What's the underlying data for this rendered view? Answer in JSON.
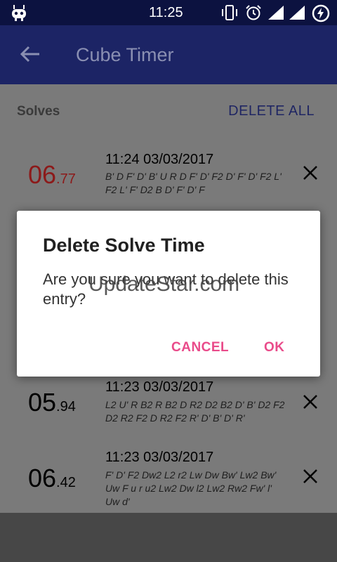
{
  "statusbar": {
    "time": "11:25"
  },
  "appbar": {
    "title": "Cube Timer"
  },
  "solves": {
    "label": "Solves",
    "delete_all": "DELETE ALL"
  },
  "rows": [
    {
      "whole": "06",
      "frac": ".77",
      "date": "11:24 03/03/2017",
      "scramble": "B' D F' D' B' U R D F' D' F2 D' F' D' F2 L' F2 L' F' D2 B D' F' D' F"
    },
    {
      "whole": "05",
      "frac": ".94",
      "date": "11:23 03/03/2017",
      "scramble": "L2 U' R B2 R B2 D R2 D2 B2 D' B' D2 F2 D2 R2 F2 D R2 F2 R' D' B' D' R'"
    },
    {
      "whole": "06",
      "frac": ".42",
      "date": "11:23 03/03/2017",
      "scramble": "F' D' F2 Dw2 L2 r2 Lw Dw Bw' Lw2 Bw' Uw F u r u2 Lw2 Dw l2 Lw2 Rw2 Fw' l' Uw d'"
    }
  ],
  "dialog": {
    "title": "Delete Solve Time",
    "message": "Are you sure you want to delete this entry?",
    "cancel": "CANCEL",
    "ok": "OK"
  },
  "watermark": "UpdateStar.com",
  "colors": {
    "appbar": "#1c2465",
    "statusbar": "#0c1240",
    "accent": "#e94b8a",
    "best_time": "#8c1a1a"
  }
}
